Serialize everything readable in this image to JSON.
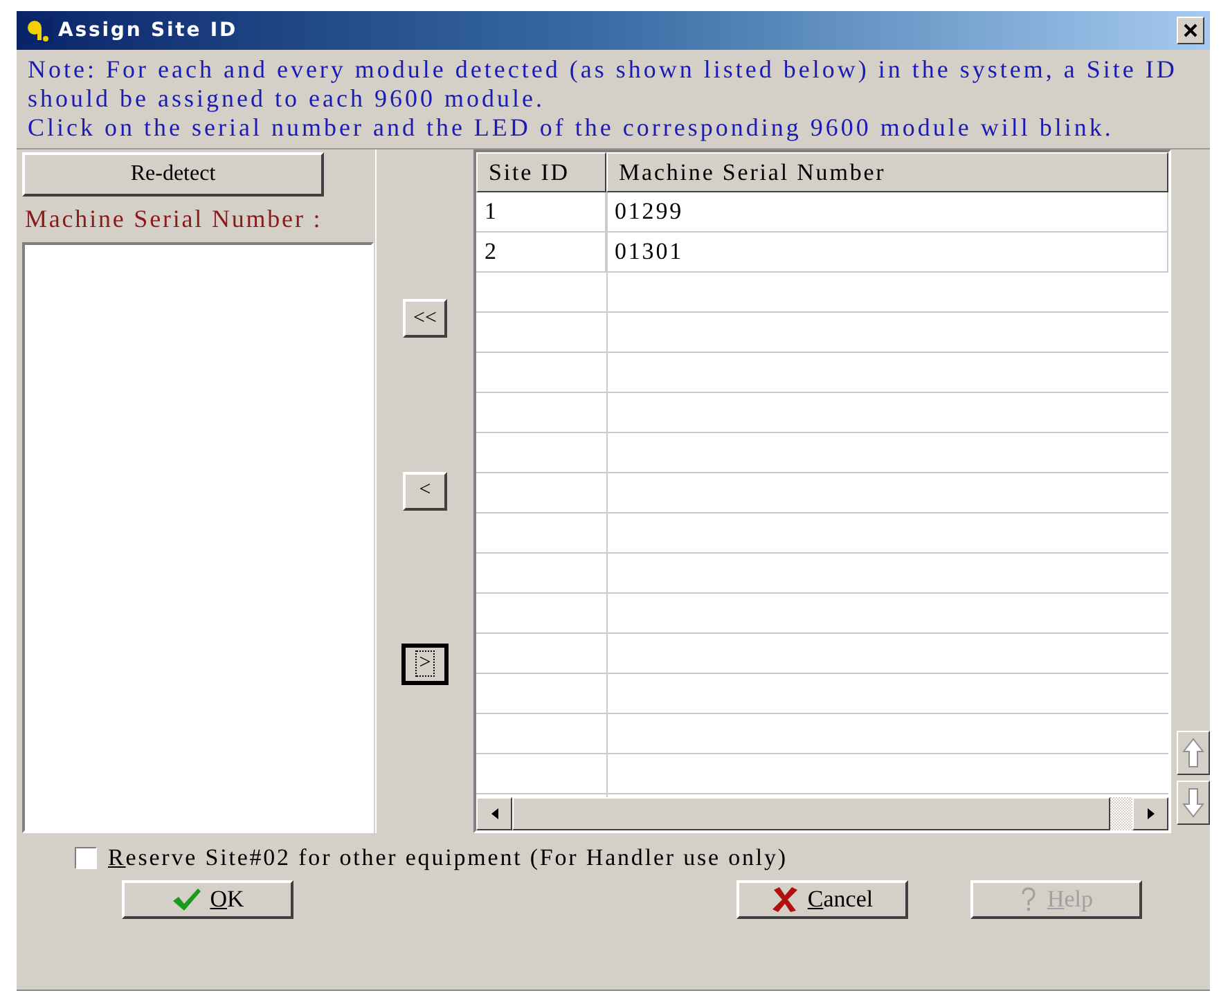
{
  "window": {
    "title": "Assign Site ID"
  },
  "note": [
    "Note: For each and every module detected (as shown listed below) in the system, a Site ID should be assigned to each 9600 module.",
    "Click on the serial number and the LED of the corresponding 9600 module will blink."
  ],
  "redetect_button": "Re-detect",
  "serial_label": "Machine Serial Number :",
  "move_buttons": [
    {
      "label": "<<",
      "focused": false
    },
    {
      "label": "<",
      "focused": false
    },
    {
      "label": ">",
      "focused": true
    }
  ],
  "table": {
    "columns": [
      "Site ID",
      "Machine Serial Number"
    ],
    "rows": [
      [
        "1",
        "01299"
      ],
      [
        "2",
        "01301"
      ]
    ]
  },
  "reserve": {
    "label": "Reserve Site#02 for other equipment (For Handler use only)",
    "checked": false
  },
  "buttons": [
    {
      "kind": "ok",
      "label": "OK",
      "disabled": false
    },
    {
      "kind": "cancel",
      "label": "Cancel",
      "disabled": false
    },
    {
      "kind": "help",
      "label": "Help",
      "disabled": true
    }
  ]
}
